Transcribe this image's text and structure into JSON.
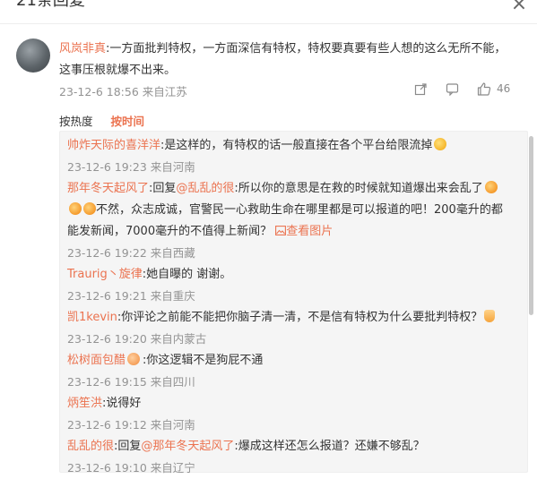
{
  "header": {
    "title": "21条回复",
    "close_icon": "close-icon"
  },
  "main_comment": {
    "author": "风岚非真",
    "text": ":一方面批判特权，一方面深信有特权，特权要真要有些人想的这么无所不能，这事压根就爆不出来。",
    "meta": "23-12-6 18:56 来自江苏",
    "share_icon": "share-icon",
    "comment_icon": "comment-icon",
    "like_icon": "like-icon",
    "like_count": "46"
  },
  "sort_tabs": [
    {
      "label": "按热度"
    },
    {
      "label": "按时间"
    }
  ],
  "replies": [
    {
      "author": "帅炸天际的喜洋洋",
      "text": ":是这样的，有特权的话一般直接在各个平台给限流掉",
      "meta": "23-12-6 19:23 来自河南"
    },
    {
      "author": "那年冬天起风了",
      "prefix": ":回复",
      "mention": "@乱乱的很",
      "text": ":所以你的意思是在救的时候就知道爆出来会乱了",
      "text2": "不然，众志成诚，官警民一心救助生命在哪里都是可以报道的吧！200毫升的都能发新闻，7000毫升的不值得上新闻？",
      "pic_link": "查看图片",
      "meta": "23-12-6 19:22 来自西藏"
    },
    {
      "author": "Traurig丶旋律",
      "text": ":她自曝的 谢谢。",
      "meta": "23-12-6 19:21 来自重庆"
    },
    {
      "author": "凯1kevin",
      "text": ":你评论之前能不能把你脑子清一清，不是信有特权为什么要批判特权？",
      "meta": "23-12-6 19:20 来自内蒙古"
    },
    {
      "author": "松树面包醋",
      "text": ":你这逻辑不是狗屁不通",
      "meta": "23-12-6 19:15 来自四川"
    },
    {
      "author": "炳笙洪",
      "text": ":说得好",
      "meta": "23-12-6 19:12 来自河南"
    },
    {
      "author": "乱乱的很",
      "prefix": ":回复",
      "mention": "@那年冬天起风了",
      "text": ":爆成这样还怎么报道？还嫌不够乱？",
      "meta": "23-12-6 19:10 来自辽宁"
    }
  ]
}
